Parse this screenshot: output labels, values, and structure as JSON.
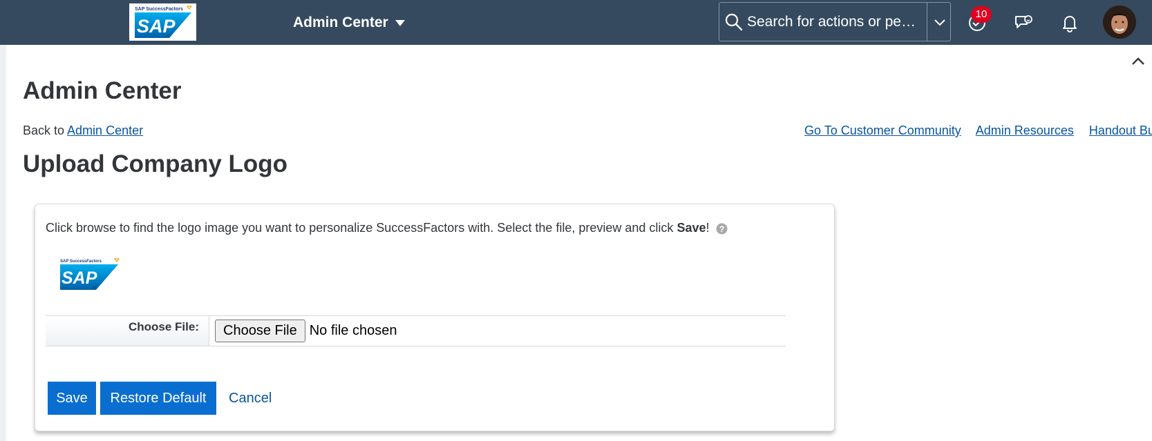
{
  "shell": {
    "logo_alt": "SAP SuccessFactors",
    "product_menu_label": "Admin Center",
    "search_placeholder": "Search for actions or peo...",
    "notification_count": "10",
    "icons": [
      "search-icon",
      "chevron-down-icon",
      "to-do-check-icon",
      "feedback-chat-icon",
      "bell-icon",
      "user-avatar"
    ]
  },
  "page": {
    "title": "Admin Center",
    "back_prefix": "Back to",
    "back_link": "Admin Center",
    "top_links": [
      "Go To Customer Community",
      "Admin Resources",
      "Handout Builder"
    ],
    "section_title": "Upload Company Logo"
  },
  "panel": {
    "instructions_prefix": "Click browse to find the logo image you want to personalize SuccessFactors with. Select the file, preview and click ",
    "instructions_bold": "Save",
    "instructions_suffix": "!",
    "preview_logo_alt": "SAP SuccessFactors",
    "file_label": "Choose File:",
    "file_button": "Choose File",
    "file_status": "No file chosen",
    "buttons": {
      "save": "Save",
      "restore": "Restore Default",
      "cancel": "Cancel"
    }
  },
  "colors": {
    "shellbar": "#354a5f",
    "primary": "#0a6ed1",
    "link": "#0854a0",
    "badge": "#e0001f"
  }
}
